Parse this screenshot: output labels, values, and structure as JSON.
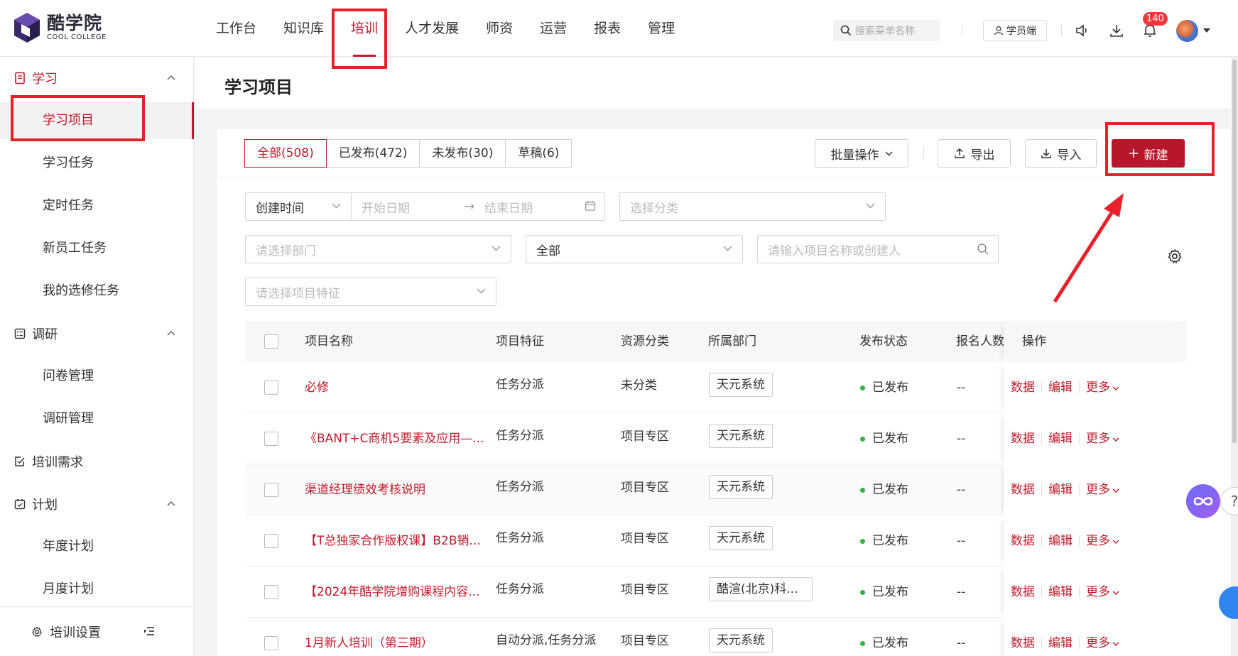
{
  "brand": {
    "name_cn": "酷学院",
    "name_en": "COOL COLLEGE",
    "color": "#c0192b"
  },
  "nav": {
    "items": [
      {
        "label": "工作台"
      },
      {
        "label": "知识库"
      },
      {
        "label": "培训"
      },
      {
        "label": "人才发展"
      },
      {
        "label": "师资"
      },
      {
        "label": "运营"
      },
      {
        "label": "报表"
      },
      {
        "label": "管理"
      }
    ],
    "active": "培训"
  },
  "header": {
    "search_placeholder": "搜索菜单名称",
    "student_label": "学员端",
    "notification_count": "140"
  },
  "sidebar": {
    "groups": [
      {
        "label": "学习",
        "items": [
          "学习项目",
          "学习任务",
          "定时任务",
          "新员工任务",
          "我的选修任务"
        ]
      },
      {
        "label": "调研",
        "items": [
          "问卷管理",
          "调研管理"
        ]
      },
      {
        "label": "培训需求",
        "items": []
      },
      {
        "label": "计划",
        "items": [
          "年度计划",
          "月度计划"
        ]
      }
    ],
    "active_item": "学习项目",
    "footer_label": "培训设置"
  },
  "page": {
    "title": "学习项目"
  },
  "tabs": [
    {
      "label": "全部(508)"
    },
    {
      "label": "已发布(472)"
    },
    {
      "label": "未发布(30)"
    },
    {
      "label": "草稿(6)"
    }
  ],
  "actions": {
    "batch": "批量操作",
    "export": "导出",
    "import": "导入",
    "create": "新建"
  },
  "filters": {
    "time_type": "创建时间",
    "start_placeholder": "开始日期",
    "end_placeholder": "结束日期",
    "category_placeholder": "选择分类",
    "dept_placeholder": "请选择部门",
    "status_value": "全部",
    "search_placeholder": "请输入项目名称或创建人",
    "feature_placeholder": "请选择项目特征"
  },
  "table": {
    "columns": [
      "项目名称",
      "项目特征",
      "资源分类",
      "所属部门",
      "发布状态",
      "报名人数",
      "操作"
    ],
    "rows": [
      {
        "name": "必修",
        "feature": "任务分派",
        "category": "未分类",
        "dept": "天元系统",
        "status": "已发布",
        "count": "--"
      },
      {
        "name": "《BANT+C商机5要素及应用—...",
        "feature": "任务分派",
        "category": "项目专区",
        "dept": "天元系统",
        "status": "已发布",
        "count": "--"
      },
      {
        "name": "渠道经理绩效考核说明",
        "feature": "任务分派",
        "category": "项目专区",
        "dept": "天元系统",
        "status": "已发布",
        "count": "--"
      },
      {
        "name": "【T总独家合作版权课】B2B销...",
        "feature": "任务分派",
        "category": "项目专区",
        "dept": "天元系统",
        "status": "已发布",
        "count": "--"
      },
      {
        "name": "【2024年酷学院增购课程内容...",
        "feature": "任务分派",
        "category": "项目专区",
        "dept": "酷渲(北京)科...",
        "status": "已发布",
        "count": "--"
      },
      {
        "name": "1月新人培训（第三期）",
        "feature": "自动分派,任务分派",
        "category": "项目专区",
        "dept": "天元系统",
        "status": "已发布",
        "count": "--"
      }
    ],
    "row_actions": [
      "数据",
      "编辑",
      "更多"
    ]
  }
}
